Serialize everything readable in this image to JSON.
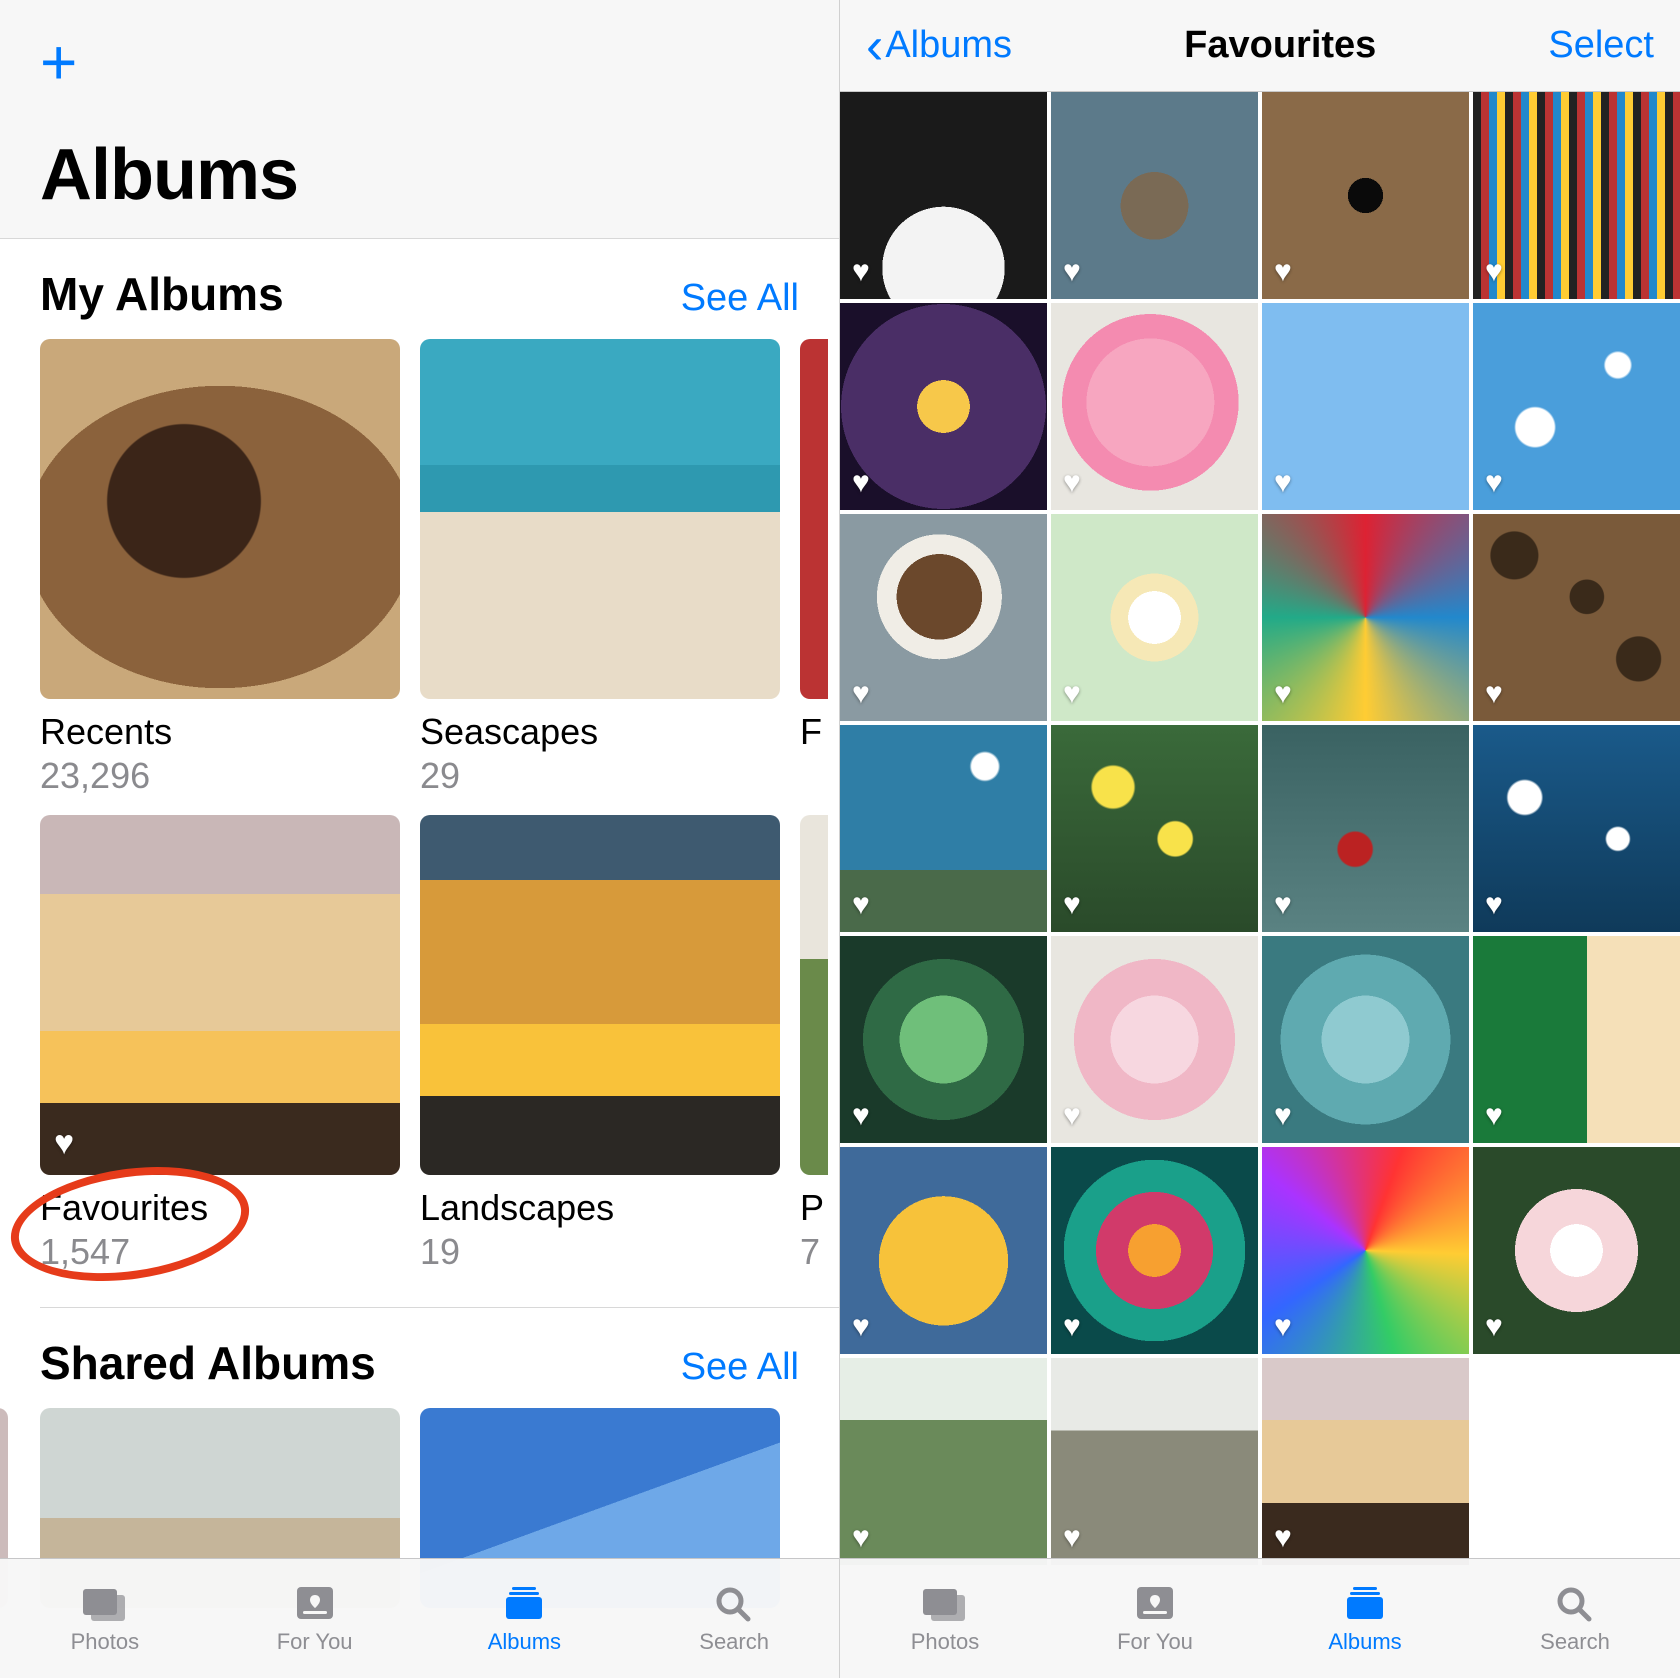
{
  "colors": {
    "accent": "#007aff",
    "annotation": "#e63b1a",
    "inactive": "#8e8e93"
  },
  "left": {
    "add_symbol": "+",
    "title": "Albums",
    "sections": {
      "my_albums": {
        "title": "My Albums",
        "see_all": "See All"
      },
      "shared_albums": {
        "title": "Shared Albums",
        "see_all": "See All"
      }
    },
    "albums": {
      "row1": [
        {
          "name": "Recents",
          "count": "23,296",
          "thumb": "t-recents"
        },
        {
          "name": "Seascapes",
          "count": "29",
          "thumb": "t-seascapes"
        },
        {
          "name_visible": "F",
          "count_visible": "",
          "thumb": "t-peek1"
        }
      ],
      "row2": [
        {
          "name": "Favourites",
          "count": "1,547",
          "thumb": "t-favourites",
          "hearted": true,
          "annotated": true
        },
        {
          "name": "Landscapes",
          "count": "19",
          "thumb": "t-landscapes"
        },
        {
          "name_visible": "P",
          "count_visible": "7",
          "thumb": "t-peek2"
        }
      ]
    },
    "shared_thumbs": [
      "t-shared1",
      "t-shared2"
    ]
  },
  "right": {
    "back_label": "Albums",
    "title": "Favourites",
    "select_label": "Select",
    "grid_rows": 7,
    "grid_cols": 4,
    "last_row_count": 3,
    "heart_symbol": "♥"
  },
  "tabbar": {
    "tabs": [
      {
        "id": "photos",
        "label": "Photos",
        "icon": "photos-icon"
      },
      {
        "id": "for_you",
        "label": "For You",
        "icon": "for-you-icon"
      },
      {
        "id": "albums",
        "label": "Albums",
        "icon": "albums-icon"
      },
      {
        "id": "search",
        "label": "Search",
        "icon": "search-icon"
      }
    ],
    "active": "albums"
  }
}
